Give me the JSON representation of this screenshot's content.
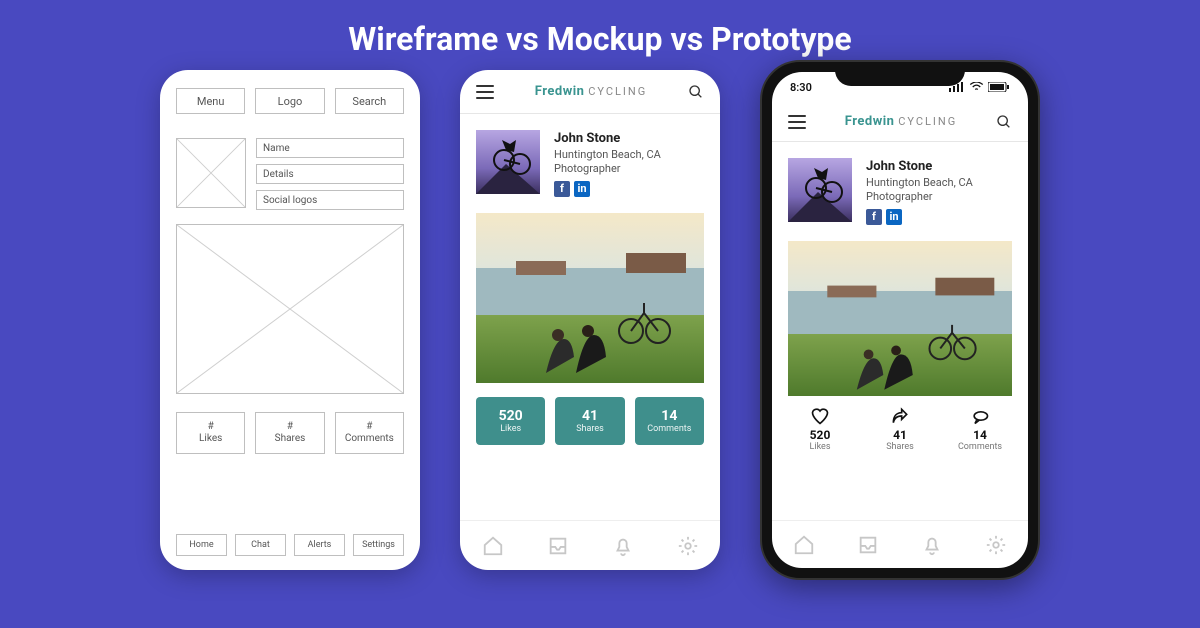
{
  "title": "Wireframe vs Mockup vs Prototype",
  "wireframe": {
    "top": {
      "menu": "Menu",
      "logo": "Logo",
      "search": "Search"
    },
    "profile": {
      "name": "Name",
      "details": "Details",
      "social": "Social logos"
    },
    "stats": {
      "likes_label": "# Likes",
      "shares_label": "# Shares",
      "comments_label": "# Comments"
    },
    "nav": {
      "home": "Home",
      "chat": "Chat",
      "alerts": "Alerts",
      "settings": "Settings"
    }
  },
  "app": {
    "brand_primary": "Fredwin",
    "brand_secondary": "CYCLING",
    "profile": {
      "name": "John Stone",
      "location": "Huntington Beach, CA",
      "role": "Photographer"
    },
    "stats": {
      "likes": "520",
      "likes_label": "Likes",
      "shares": "41",
      "shares_label": "Shares",
      "comments": "14",
      "comments_label": "Comments"
    }
  },
  "device": {
    "time": "8:30"
  }
}
